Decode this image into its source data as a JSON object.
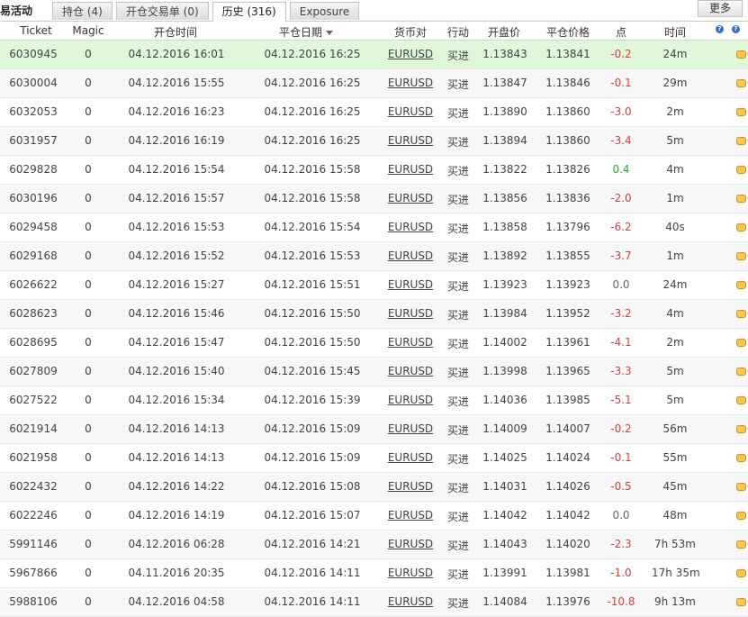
{
  "title": "易活动",
  "tabs": [
    {
      "label": "持仓 (4)",
      "active": false
    },
    {
      "label": "开仓交易单 (0)",
      "active": false
    },
    {
      "label": "历史 (316)",
      "active": true
    },
    {
      "label": "Exposure",
      "active": false
    }
  ],
  "more_label": "更多",
  "columns": {
    "ticket": "Ticket",
    "magic": "Magic",
    "open_time": "开仓时间",
    "close_date": "平仓日期",
    "symbol": "货币对",
    "action": "行动",
    "open_price": "开盘价",
    "close_price": "平仓价格",
    "points": "点",
    "time": "时间"
  },
  "rows": [
    {
      "ticket": "6030945",
      "magic": "0",
      "open": "04.12.2016 16:01",
      "close": "04.12.2016 16:25",
      "symbol": "EURUSD",
      "action": "买进",
      "open_price": "1.13843",
      "close_price": "1.13841",
      "points": "-0.2",
      "time": "24m"
    },
    {
      "ticket": "6030004",
      "magic": "0",
      "open": "04.12.2016 15:55",
      "close": "04.12.2016 16:25",
      "symbol": "EURUSD",
      "action": "买进",
      "open_price": "1.13847",
      "close_price": "1.13846",
      "points": "-0.1",
      "time": "29m"
    },
    {
      "ticket": "6032053",
      "magic": "0",
      "open": "04.12.2016 16:23",
      "close": "04.12.2016 16:25",
      "symbol": "EURUSD",
      "action": "买进",
      "open_price": "1.13890",
      "close_price": "1.13860",
      "points": "-3.0",
      "time": "2m"
    },
    {
      "ticket": "6031957",
      "magic": "0",
      "open": "04.12.2016 16:19",
      "close": "04.12.2016 16:25",
      "symbol": "EURUSD",
      "action": "买进",
      "open_price": "1.13894",
      "close_price": "1.13860",
      "points": "-3.4",
      "time": "5m"
    },
    {
      "ticket": "6029828",
      "magic": "0",
      "open": "04.12.2016 15:54",
      "close": "04.12.2016 15:58",
      "symbol": "EURUSD",
      "action": "买进",
      "open_price": "1.13822",
      "close_price": "1.13826",
      "points": "0.4",
      "time": "4m"
    },
    {
      "ticket": "6030196",
      "magic": "0",
      "open": "04.12.2016 15:57",
      "close": "04.12.2016 15:58",
      "symbol": "EURUSD",
      "action": "买进",
      "open_price": "1.13856",
      "close_price": "1.13836",
      "points": "-2.0",
      "time": "1m"
    },
    {
      "ticket": "6029458",
      "magic": "0",
      "open": "04.12.2016 15:53",
      "close": "04.12.2016 15:54",
      "symbol": "EURUSD",
      "action": "买进",
      "open_price": "1.13858",
      "close_price": "1.13796",
      "points": "-6.2",
      "time": "40s"
    },
    {
      "ticket": "6029168",
      "magic": "0",
      "open": "04.12.2016 15:52",
      "close": "04.12.2016 15:53",
      "symbol": "EURUSD",
      "action": "买进",
      "open_price": "1.13892",
      "close_price": "1.13855",
      "points": "-3.7",
      "time": "1m"
    },
    {
      "ticket": "6026622",
      "magic": "0",
      "open": "04.12.2016 15:27",
      "close": "04.12.2016 15:51",
      "symbol": "EURUSD",
      "action": "买进",
      "open_price": "1.13923",
      "close_price": "1.13923",
      "points": "0.0",
      "time": "24m"
    },
    {
      "ticket": "6028623",
      "magic": "0",
      "open": "04.12.2016 15:46",
      "close": "04.12.2016 15:50",
      "symbol": "EURUSD",
      "action": "买进",
      "open_price": "1.13984",
      "close_price": "1.13952",
      "points": "-3.2",
      "time": "4m"
    },
    {
      "ticket": "6028695",
      "magic": "0",
      "open": "04.12.2016 15:47",
      "close": "04.12.2016 15:50",
      "symbol": "EURUSD",
      "action": "买进",
      "open_price": "1.14002",
      "close_price": "1.13961",
      "points": "-4.1",
      "time": "2m"
    },
    {
      "ticket": "6027809",
      "magic": "0",
      "open": "04.12.2016 15:40",
      "close": "04.12.2016 15:45",
      "symbol": "EURUSD",
      "action": "买进",
      "open_price": "1.13998",
      "close_price": "1.13965",
      "points": "-3.3",
      "time": "5m"
    },
    {
      "ticket": "6027522",
      "magic": "0",
      "open": "04.12.2016 15:34",
      "close": "04.12.2016 15:39",
      "symbol": "EURUSD",
      "action": "买进",
      "open_price": "1.14036",
      "close_price": "1.13985",
      "points": "-5.1",
      "time": "5m"
    },
    {
      "ticket": "6021914",
      "magic": "0",
      "open": "04.12.2016 14:13",
      "close": "04.12.2016 15:09",
      "symbol": "EURUSD",
      "action": "买进",
      "open_price": "1.14009",
      "close_price": "1.14007",
      "points": "-0.2",
      "time": "56m"
    },
    {
      "ticket": "6021958",
      "magic": "0",
      "open": "04.12.2016 14:13",
      "close": "04.12.2016 15:09",
      "symbol": "EURUSD",
      "action": "买进",
      "open_price": "1.14025",
      "close_price": "1.14024",
      "points": "-0.1",
      "time": "55m"
    },
    {
      "ticket": "6022432",
      "magic": "0",
      "open": "04.12.2016 14:22",
      "close": "04.12.2016 15:08",
      "symbol": "EURUSD",
      "action": "买进",
      "open_price": "1.14031",
      "close_price": "1.14026",
      "points": "-0.5",
      "time": "45m"
    },
    {
      "ticket": "6022246",
      "magic": "0",
      "open": "04.12.2016 14:19",
      "close": "04.12.2016 15:07",
      "symbol": "EURUSD",
      "action": "买进",
      "open_price": "1.14042",
      "close_price": "1.14042",
      "points": "0.0",
      "time": "48m"
    },
    {
      "ticket": "5991146",
      "magic": "0",
      "open": "04.12.2016 06:28",
      "close": "04.12.2016 14:21",
      "symbol": "EURUSD",
      "action": "买进",
      "open_price": "1.14043",
      "close_price": "1.14020",
      "points": "-2.3",
      "time": "7h 53m"
    },
    {
      "ticket": "5967866",
      "magic": "0",
      "open": "04.11.2016 20:35",
      "close": "04.12.2016 14:11",
      "symbol": "EURUSD",
      "action": "买进",
      "open_price": "1.13991",
      "close_price": "1.13981",
      "points": "-1.0",
      "time": "17h 35m"
    },
    {
      "ticket": "5988106",
      "magic": "0",
      "open": "04.12.2016 04:58",
      "close": "04.12.2016 14:11",
      "symbol": "EURUSD",
      "action": "买进",
      "open_price": "1.14084",
      "close_price": "1.13976",
      "points": "-10.8",
      "time": "9h 13m"
    }
  ],
  "colors": {
    "selected_row": "#e0f7dc",
    "positive": "#2aa83a",
    "negative": "#e03c3c"
  }
}
